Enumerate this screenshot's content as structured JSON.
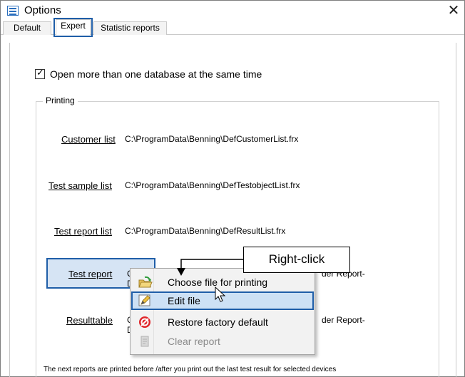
{
  "window": {
    "title": "Options",
    "close_glyph": "✕"
  },
  "tabs": [
    {
      "label": "Default"
    },
    {
      "label": "Expert"
    },
    {
      "label": "Statistic reports"
    }
  ],
  "expert": {
    "checkbox_label": "Open more than one database at the same time",
    "checkbox_checked": true,
    "group_title": "Printing",
    "rows": [
      {
        "link": "Customer list",
        "path": "C:\\ProgramData\\Benning\\DefCustomerList.frx"
      },
      {
        "link": "Test sample list",
        "path": "C:\\ProgramData\\Benning\\DefTestobjectList.frx"
      },
      {
        "link": "Test report list",
        "path": "C:\\ProgramData\\Benning\\DefResultList.frx"
      },
      {
        "link": "Test report",
        "path_visible_start": "C:\\",
        "path_visible_start2": "D",
        "path_visible_end": "der Report-"
      },
      {
        "link": "Resulttable",
        "path_visible_start": "C",
        "path_visible_start2": "D",
        "path_visible_end": "der Report-"
      }
    ],
    "footer": "The next reports are printed before /after you print out the last test result for selected devices"
  },
  "context_menu": {
    "items": [
      {
        "label": "Choose file for printing",
        "icon": "open-folder-icon",
        "state": "normal"
      },
      {
        "label": "Edit file",
        "icon": "edit-icon",
        "state": "active"
      },
      {
        "label": "Restore factory default",
        "icon": "restore-icon",
        "state": "normal"
      },
      {
        "label": "Clear report",
        "icon": "clear-report-icon",
        "state": "disabled"
      }
    ]
  },
  "annotation": {
    "callout_text": "Right-click"
  },
  "colors": {
    "highlight_border": "#1f5ea8",
    "highlight_fill": "#d6e4f4",
    "menu_active": "#cde1f5"
  }
}
